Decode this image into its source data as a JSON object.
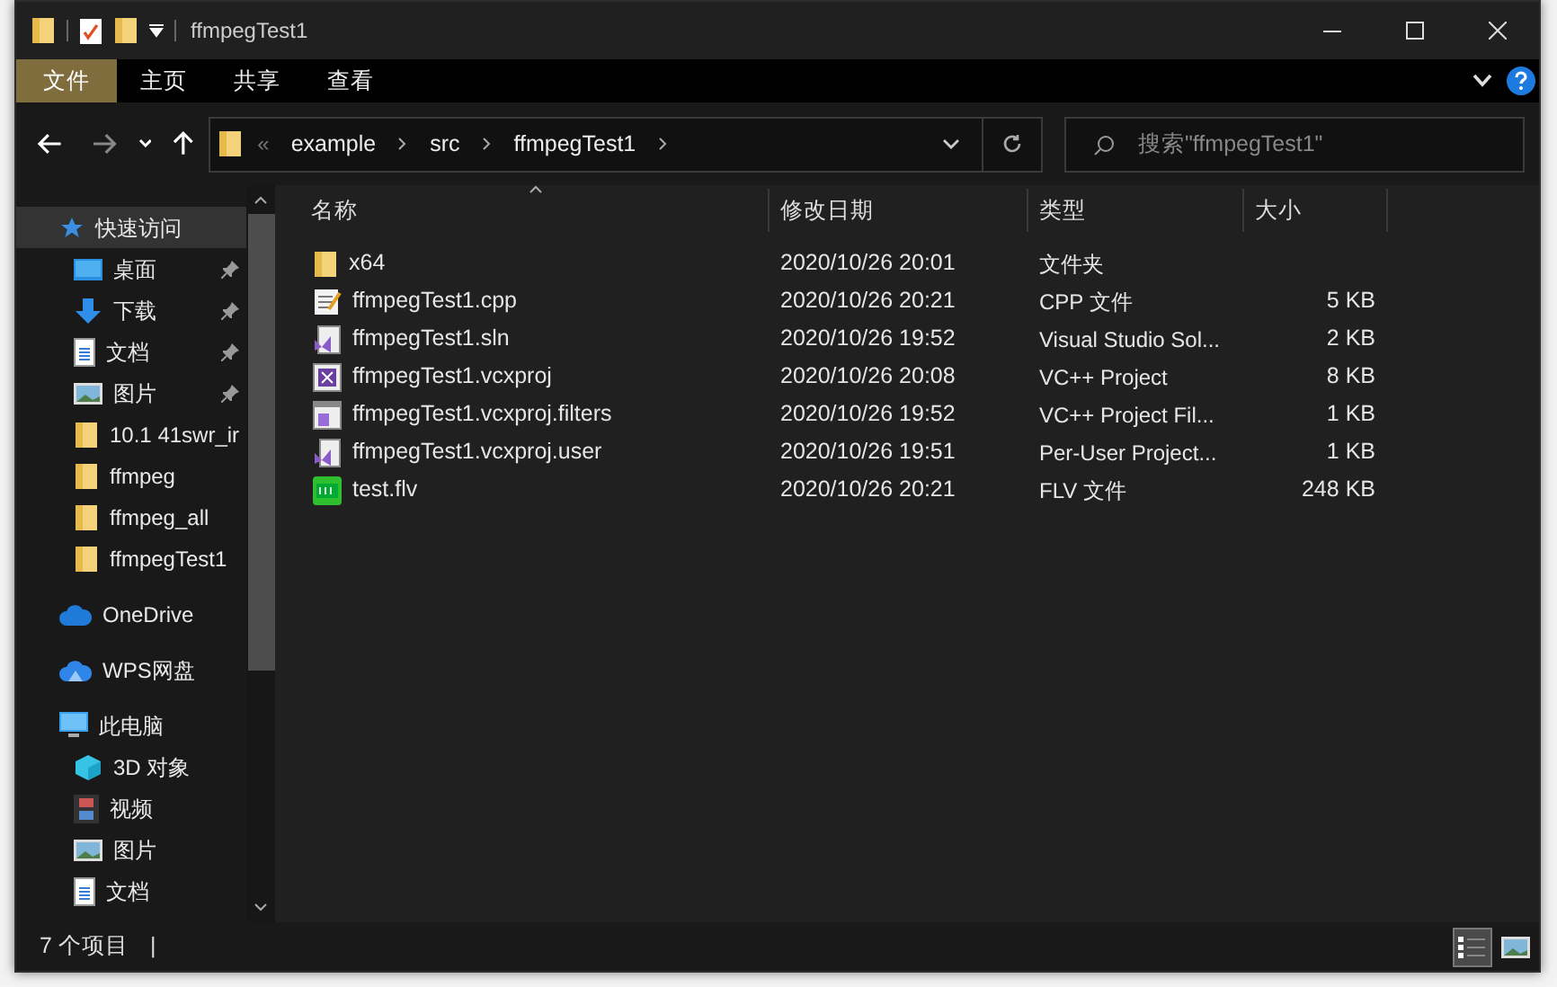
{
  "window": {
    "title": "ffmpegTest1"
  },
  "ribbon_tabs": [
    {
      "label": "文件",
      "selected": true
    },
    {
      "label": "主页",
      "selected": false
    },
    {
      "label": "共享",
      "selected": false
    },
    {
      "label": "查看",
      "selected": false
    }
  ],
  "address": {
    "crumbs": [
      "example",
      "src",
      "ffmpegTest1"
    ],
    "overflow": "«"
  },
  "search": {
    "placeholder": "搜索\"ffmpegTest1\""
  },
  "nav": [
    {
      "label": "快速访问",
      "kind": "star",
      "selected": true,
      "children": [
        {
          "label": "桌面",
          "kind": "desktop",
          "pinned": true
        },
        {
          "label": "下载",
          "kind": "download",
          "pinned": true
        },
        {
          "label": "文档",
          "kind": "document",
          "pinned": true
        },
        {
          "label": "图片",
          "kind": "pictures",
          "pinned": true
        },
        {
          "label": "10.1 41swr_ir",
          "kind": "folder",
          "pinned": false
        },
        {
          "label": "ffmpeg",
          "kind": "folder",
          "pinned": false
        },
        {
          "label": "ffmpeg_all",
          "kind": "folder",
          "pinned": false
        },
        {
          "label": "ffmpegTest1",
          "kind": "folder",
          "pinned": false
        }
      ]
    },
    {
      "label": "OneDrive",
      "kind": "cloud",
      "selected": false
    },
    {
      "label": "WPS网盘",
      "kind": "wps",
      "selected": false
    },
    {
      "label": "此电脑",
      "kind": "pc",
      "selected": false,
      "children": [
        {
          "label": "3D 对象",
          "kind": "cube",
          "pinned": false
        },
        {
          "label": "视频",
          "kind": "video",
          "pinned": false
        },
        {
          "label": "图片",
          "kind": "pictures",
          "pinned": false
        },
        {
          "label": "文档",
          "kind": "document",
          "pinned": false
        }
      ]
    }
  ],
  "table": {
    "columns": [
      "名称",
      "修改日期",
      "类型",
      "大小"
    ],
    "rows": [
      {
        "kind": "folder",
        "name": "x64",
        "date": "2020/10/26 20:01",
        "type": "文件夹",
        "size": ""
      },
      {
        "kind": "cpp",
        "name": "ffmpegTest1.cpp",
        "date": "2020/10/26 20:21",
        "type": "CPP 文件",
        "size": "5 KB"
      },
      {
        "kind": "sln",
        "name": "ffmpegTest1.sln",
        "date": "2020/10/26 19:52",
        "type": "Visual Studio Sol...",
        "size": "2 KB"
      },
      {
        "kind": "vcxproj",
        "name": "ffmpegTest1.vcxproj",
        "date": "2020/10/26 20:08",
        "type": "VC++ Project",
        "size": "8 KB"
      },
      {
        "kind": "filters",
        "name": "ffmpegTest1.vcxproj.filters",
        "date": "2020/10/26 19:52",
        "type": "VC++ Project Fil...",
        "size": "1 KB"
      },
      {
        "kind": "user",
        "name": "ffmpegTest1.vcxproj.user",
        "date": "2020/10/26 19:51",
        "type": "Per-User Project...",
        "size": "1 KB"
      },
      {
        "kind": "flv",
        "name": "test.flv",
        "date": "2020/10/26 20:21",
        "type": "FLV 文件",
        "size": "248 KB"
      }
    ]
  },
  "status_bar": {
    "count": "7 个项目",
    "separator": "|"
  },
  "views": [
    {
      "kind": "details",
      "selected": true
    },
    {
      "kind": "large",
      "selected": false
    }
  ]
}
